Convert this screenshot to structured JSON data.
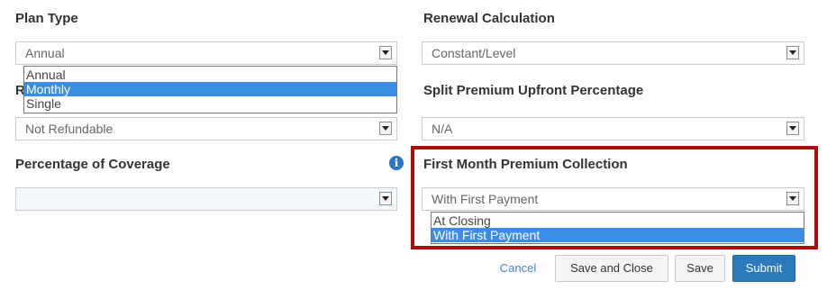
{
  "plan_type": {
    "label": "Plan Type",
    "value": "Annual",
    "options": [
      "Annual",
      "Monthly",
      "Single"
    ],
    "highlighted_option": "Monthly"
  },
  "refund_field": {
    "label_partial": "R",
    "value": "Not Refundable"
  },
  "percentage_of_coverage": {
    "label": "Percentage of Coverage",
    "value": "",
    "info_icon": "info-icon"
  },
  "renewal_calculation": {
    "label": "Renewal Calculation",
    "value": "Constant/Level"
  },
  "split_premium": {
    "label": "Split Premium Upfront Percentage",
    "value": "N/A"
  },
  "first_month_premium": {
    "label": "First Month Premium Collection",
    "value": "With First Payment",
    "options": [
      "At Closing",
      "With First Payment"
    ],
    "highlighted_option": "With First Payment",
    "highlight_color": "#b00c0c"
  },
  "actions": {
    "cancel": "Cancel",
    "save_and_close": "Save and Close",
    "save": "Save",
    "submit": "Submit"
  },
  "colors": {
    "accent": "#2a79bb",
    "selection": "#3a8ee6",
    "annotation": "#b00c0c"
  }
}
